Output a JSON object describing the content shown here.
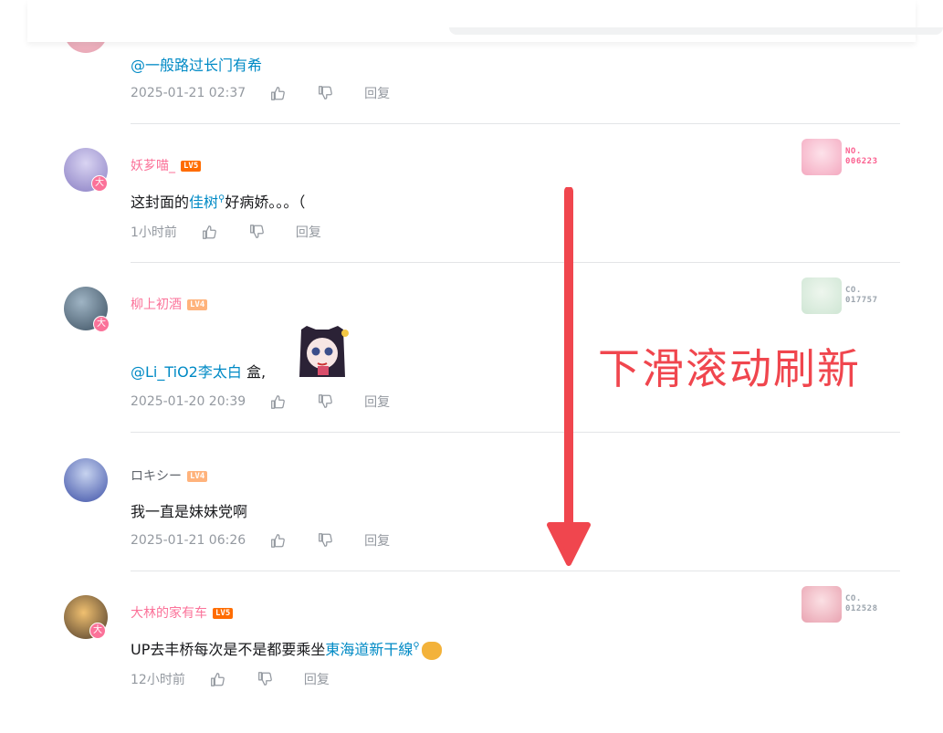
{
  "comments": [
    {
      "mention": "@一般路过长门有希",
      "time": "2025-01-21 02:37",
      "reply": "回复"
    },
    {
      "user": "妖芗喵_",
      "level": "LV5",
      "text_before": "这封面的",
      "link": "佳树",
      "text_after": "好病娇。。。（",
      "time": "1小时前",
      "reply": "回复",
      "fan_label": "NO.",
      "fan_number": "006223",
      "fan_color": "#fb5f8f"
    },
    {
      "user": "柳上初酒",
      "level": "LV4",
      "mention": "@Li_TiO2李太白",
      "text_after": " 盒,",
      "time": "2025-01-20 20:39",
      "reply": "回复",
      "fan_label": "CO.",
      "fan_number": "017757",
      "fan_color": "#9ba4ad"
    },
    {
      "user": "ロキシー",
      "level": "LV4",
      "text": "我一直是妹妹党啊",
      "time": "2025-01-21 06:26",
      "reply": "回复"
    },
    {
      "user": "大林的家有车",
      "level": "LV5",
      "text_before": "UP去丰桥每次是不是都要乘坐",
      "link": "東海道新干線",
      "time": "12小时前",
      "reply": "回复",
      "fan_label": "CO.",
      "fan_number": "012528",
      "fan_color": "#9ba4ad"
    }
  ],
  "badge": "大",
  "overlay_text": "下滑滚动刷新",
  "colors": {
    "accent": "#fb7299",
    "link": "#008ac5",
    "arrow": "#f0464e",
    "meta": "#9499a0"
  },
  "icons": [
    "like-icon",
    "dislike-icon",
    "search-icon",
    "down-arrow"
  ]
}
